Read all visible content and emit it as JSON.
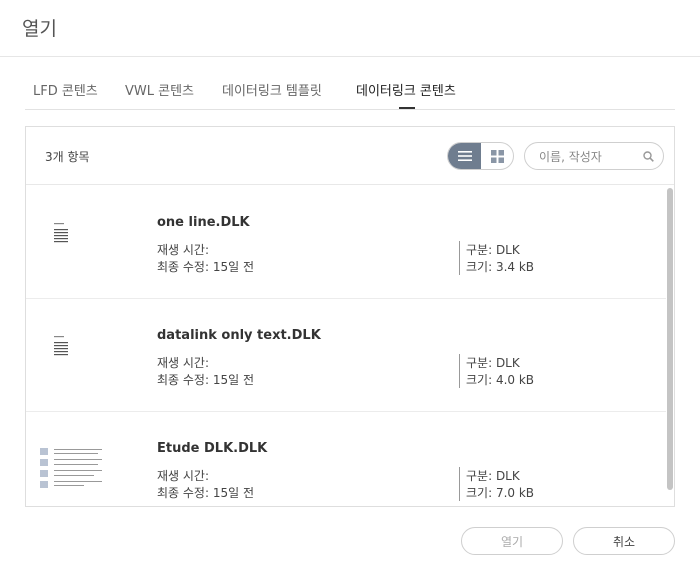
{
  "dialog": {
    "title": "열기"
  },
  "tabs": [
    {
      "label": "LFD 콘텐츠",
      "active": false
    },
    {
      "label": "VWL 콘텐츠",
      "active": false
    },
    {
      "label": "데이터링크 템플릿",
      "active": false
    },
    {
      "label": "데이터링크 콘텐츠",
      "active": true
    }
  ],
  "toolbar": {
    "item_count": "3개 항목",
    "view_list_icon": "list-view-icon",
    "view_grid_icon": "grid-view-icon",
    "active_view": "list",
    "accent_color": "#6f7d8f"
  },
  "search": {
    "placeholder": "이름, 작성자",
    "value": "",
    "icon": "search-icon"
  },
  "files": [
    {
      "name": "one line.DLK",
      "play_time": "재생 시간:",
      "modified": "최종 수정: 15일 전",
      "type": "구분: DLK",
      "size": "크기: 3.4 kB"
    },
    {
      "name": "datalink only text.DLK",
      "play_time": "재생 시간:",
      "modified": "최종 수정: 15일 전",
      "type": "구분: DLK",
      "size": "크기: 4.0 kB"
    },
    {
      "name": "Etude DLK.DLK",
      "play_time": "재생 시간:",
      "modified": "최종 수정: 15일 전",
      "type": "구분: DLK",
      "size": "크기: 7.0 kB"
    }
  ],
  "buttons": {
    "open": "열기",
    "cancel": "취소"
  }
}
